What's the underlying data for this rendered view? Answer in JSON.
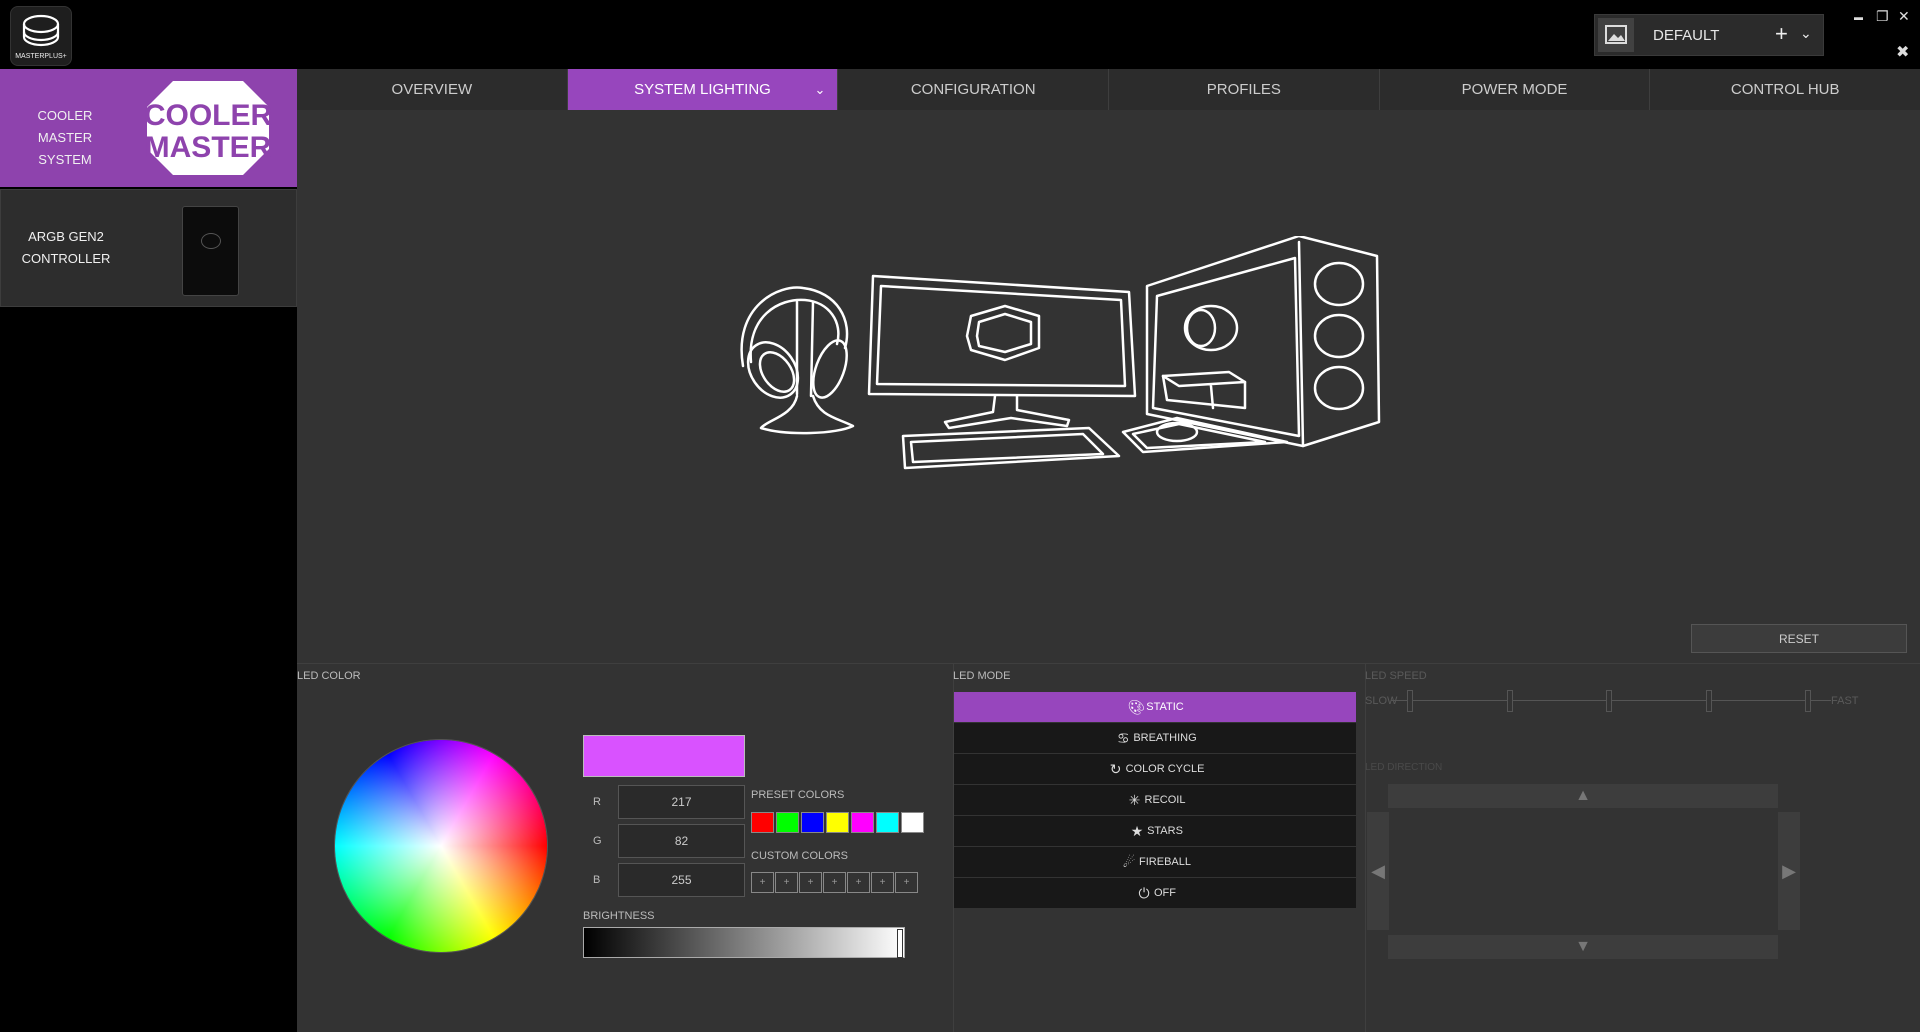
{
  "app": {
    "logo_text": "MASTERPLUS+"
  },
  "profile": {
    "name": "DEFAULT",
    "add": "+",
    "dropdown": "⌄"
  },
  "window_controls": {
    "minimize": "▬",
    "restore": "❐",
    "close": "✕",
    "pin": "✖"
  },
  "sidebar": {
    "devices": [
      {
        "label": "COOLER MASTER SYSTEM",
        "line1": "COOLER MASTER",
        "line2": "SYSTEM",
        "logo": "COOLER MASTER"
      },
      {
        "label": "ARGB GEN2 CONTROLLER",
        "line1": "ARGB GEN2",
        "line2": "CONTROLLER"
      }
    ]
  },
  "tabs": [
    "OVERVIEW",
    "SYSTEM LIGHTING",
    "CONFIGURATION",
    "PROFILES",
    "POWER MODE",
    "CONTROL HUB"
  ],
  "active_tab": "SYSTEM LIGHTING",
  "reset_label": "RESET",
  "led_color": {
    "title": "LED COLOR",
    "current_color": "#d952ff",
    "r_label": "R",
    "g_label": "G",
    "b_label": "B",
    "r": "217",
    "g": "82",
    "b": "255",
    "preset_title": "PRESET COLORS",
    "preset_colors": [
      "#ff0000",
      "#00ff00",
      "#0000ff",
      "#ffff00",
      "#ff00ff",
      "#00ffff",
      "#ffffff"
    ],
    "custom_title": "CUSTOM COLORS",
    "custom_slots": [
      "+",
      "+",
      "+",
      "+",
      "+",
      "+",
      "+"
    ],
    "brightness_title": "BRIGHTNESS",
    "brightness_value": 1.0
  },
  "led_mode": {
    "title": "LED MODE",
    "modes": [
      {
        "label": "STATIC",
        "icon": "palette-icon",
        "active": true
      },
      {
        "label": "BREATHING",
        "icon": "lungs-icon",
        "active": false
      },
      {
        "label": "COLOR CYCLE",
        "icon": "refresh-icon",
        "active": false
      },
      {
        "label": "RECOIL",
        "icon": "burst-icon",
        "active": false
      },
      {
        "label": "STARS",
        "icon": "star-icon",
        "active": false
      },
      {
        "label": "FIREBALL",
        "icon": "fireball-icon",
        "active": false
      },
      {
        "label": "OFF",
        "icon": "power-icon",
        "active": false
      }
    ]
  },
  "led_speed": {
    "title": "LED SPEED",
    "slow": "SLOW",
    "fast": "FAST"
  },
  "led_direction": {
    "title": "LED DIRECTION",
    "up": "▲",
    "down": "▼",
    "left": "◀",
    "right": "▶"
  },
  "colors": {
    "accent": "#9746bd",
    "panel": "#333333"
  }
}
